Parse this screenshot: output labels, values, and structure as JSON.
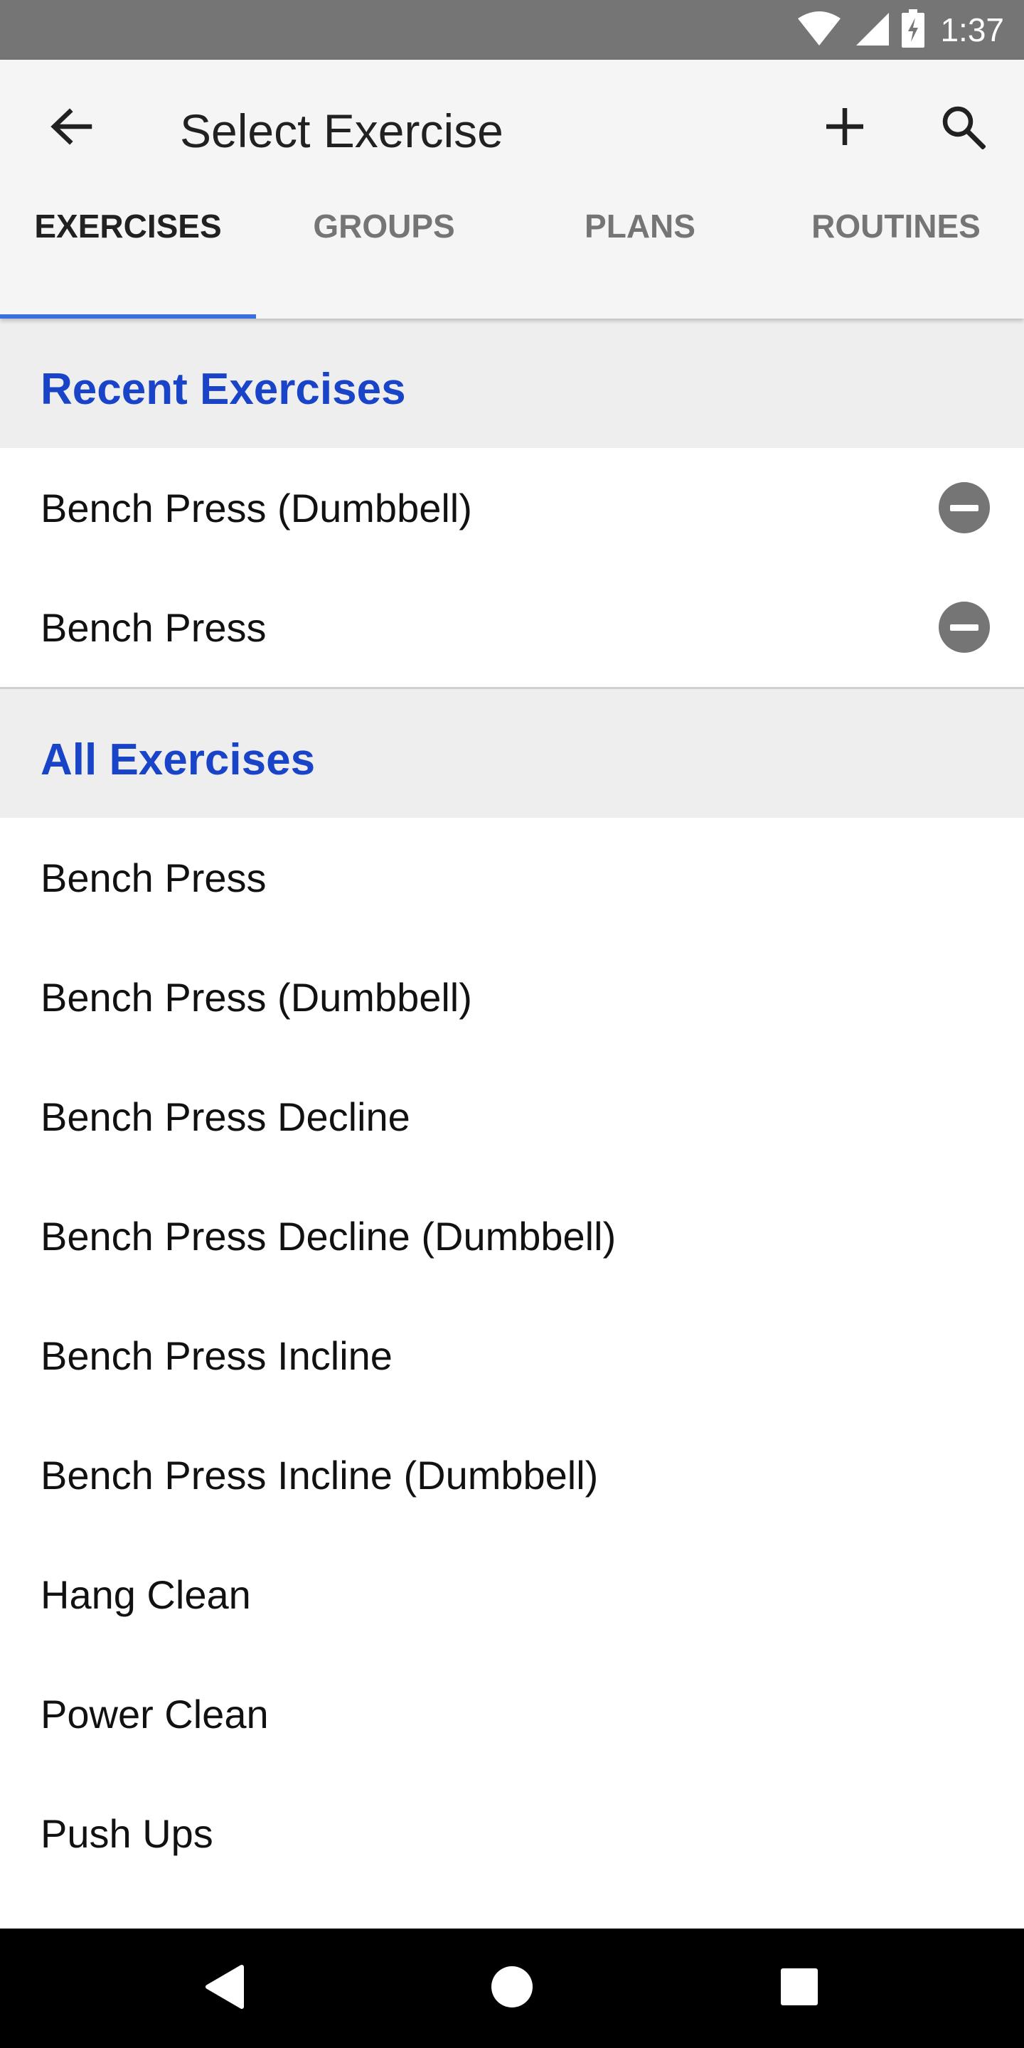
{
  "status_bar": {
    "time": "1:37",
    "icons": [
      "wifi-icon",
      "cellular-signal-icon",
      "battery-charging-icon"
    ]
  },
  "toolbar": {
    "title": "Select Exercise",
    "back_icon": "arrow-back-icon",
    "add_icon": "add-icon",
    "search_icon": "search-icon"
  },
  "tabs": [
    {
      "label": "EXERCISES",
      "active": true
    },
    {
      "label": "GROUPS",
      "active": false
    },
    {
      "label": "PLANS",
      "active": false
    },
    {
      "label": "ROUTINES",
      "active": false
    }
  ],
  "recent": {
    "header": "Recent Exercises",
    "items": [
      {
        "label": "Bench Press (Dumbbell)"
      },
      {
        "label": "Bench Press"
      }
    ]
  },
  "all": {
    "header": "All Exercises",
    "items": [
      {
        "label": "Bench Press"
      },
      {
        "label": "Bench Press (Dumbbell)"
      },
      {
        "label": "Bench Press Decline"
      },
      {
        "label": "Bench Press Decline (Dumbbell)"
      },
      {
        "label": "Bench Press Incline"
      },
      {
        "label": "Bench Press Incline (Dumbbell)"
      },
      {
        "label": "Hang Clean"
      },
      {
        "label": "Power Clean"
      },
      {
        "label": "Push Ups"
      }
    ]
  },
  "colors": {
    "accent": "#1a44c8",
    "tab_indicator": "#3a6fe0",
    "status_bar": "#757575",
    "app_bar": "#f5f5f5",
    "section_header_bg": "#eeeeee"
  }
}
